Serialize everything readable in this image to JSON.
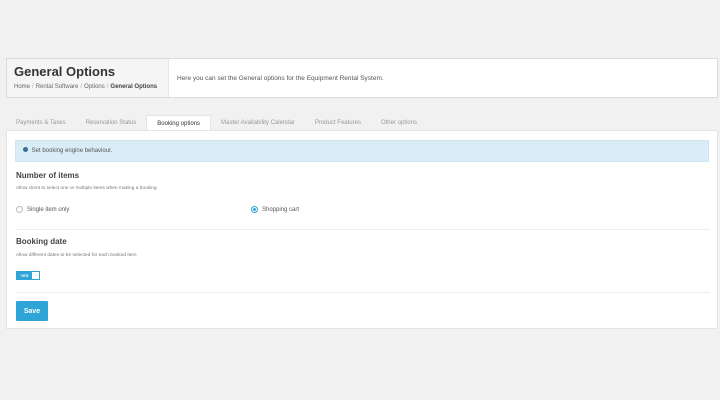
{
  "header": {
    "title": "General Options",
    "breadcrumb": [
      "Home",
      "Rental Software",
      "Options",
      "General Options"
    ],
    "description": "Here you can set the General options for the Equipment Rental System."
  },
  "tabs": [
    {
      "label": "Payments & Taxes",
      "active": false
    },
    {
      "label": "Reservation Status",
      "active": false
    },
    {
      "label": "Booking options",
      "active": true
    },
    {
      "label": "Master Availability Calendar",
      "active": false
    },
    {
      "label": "Product Features",
      "active": false
    },
    {
      "label": "Other options",
      "active": false
    }
  ],
  "info": {
    "icon": "info-circle-icon",
    "text": "Set booking engine behaviour."
  },
  "number_of_items": {
    "title": "Number of items",
    "description": "Allow client to select one or multiple items when making a booking.",
    "options": [
      {
        "label": "Single item only",
        "selected": false
      },
      {
        "label": "Shopping cart",
        "selected": true
      }
    ]
  },
  "booking_date": {
    "title": "Booking date",
    "description": "Allow different dates to be selected for each booked item",
    "toggle_label": "YES",
    "enabled": true
  },
  "save_label": "Save",
  "colors": {
    "accent": "#2fa4d7",
    "info_bg": "#d9edf7",
    "page_bg": "#f1f1f1"
  }
}
